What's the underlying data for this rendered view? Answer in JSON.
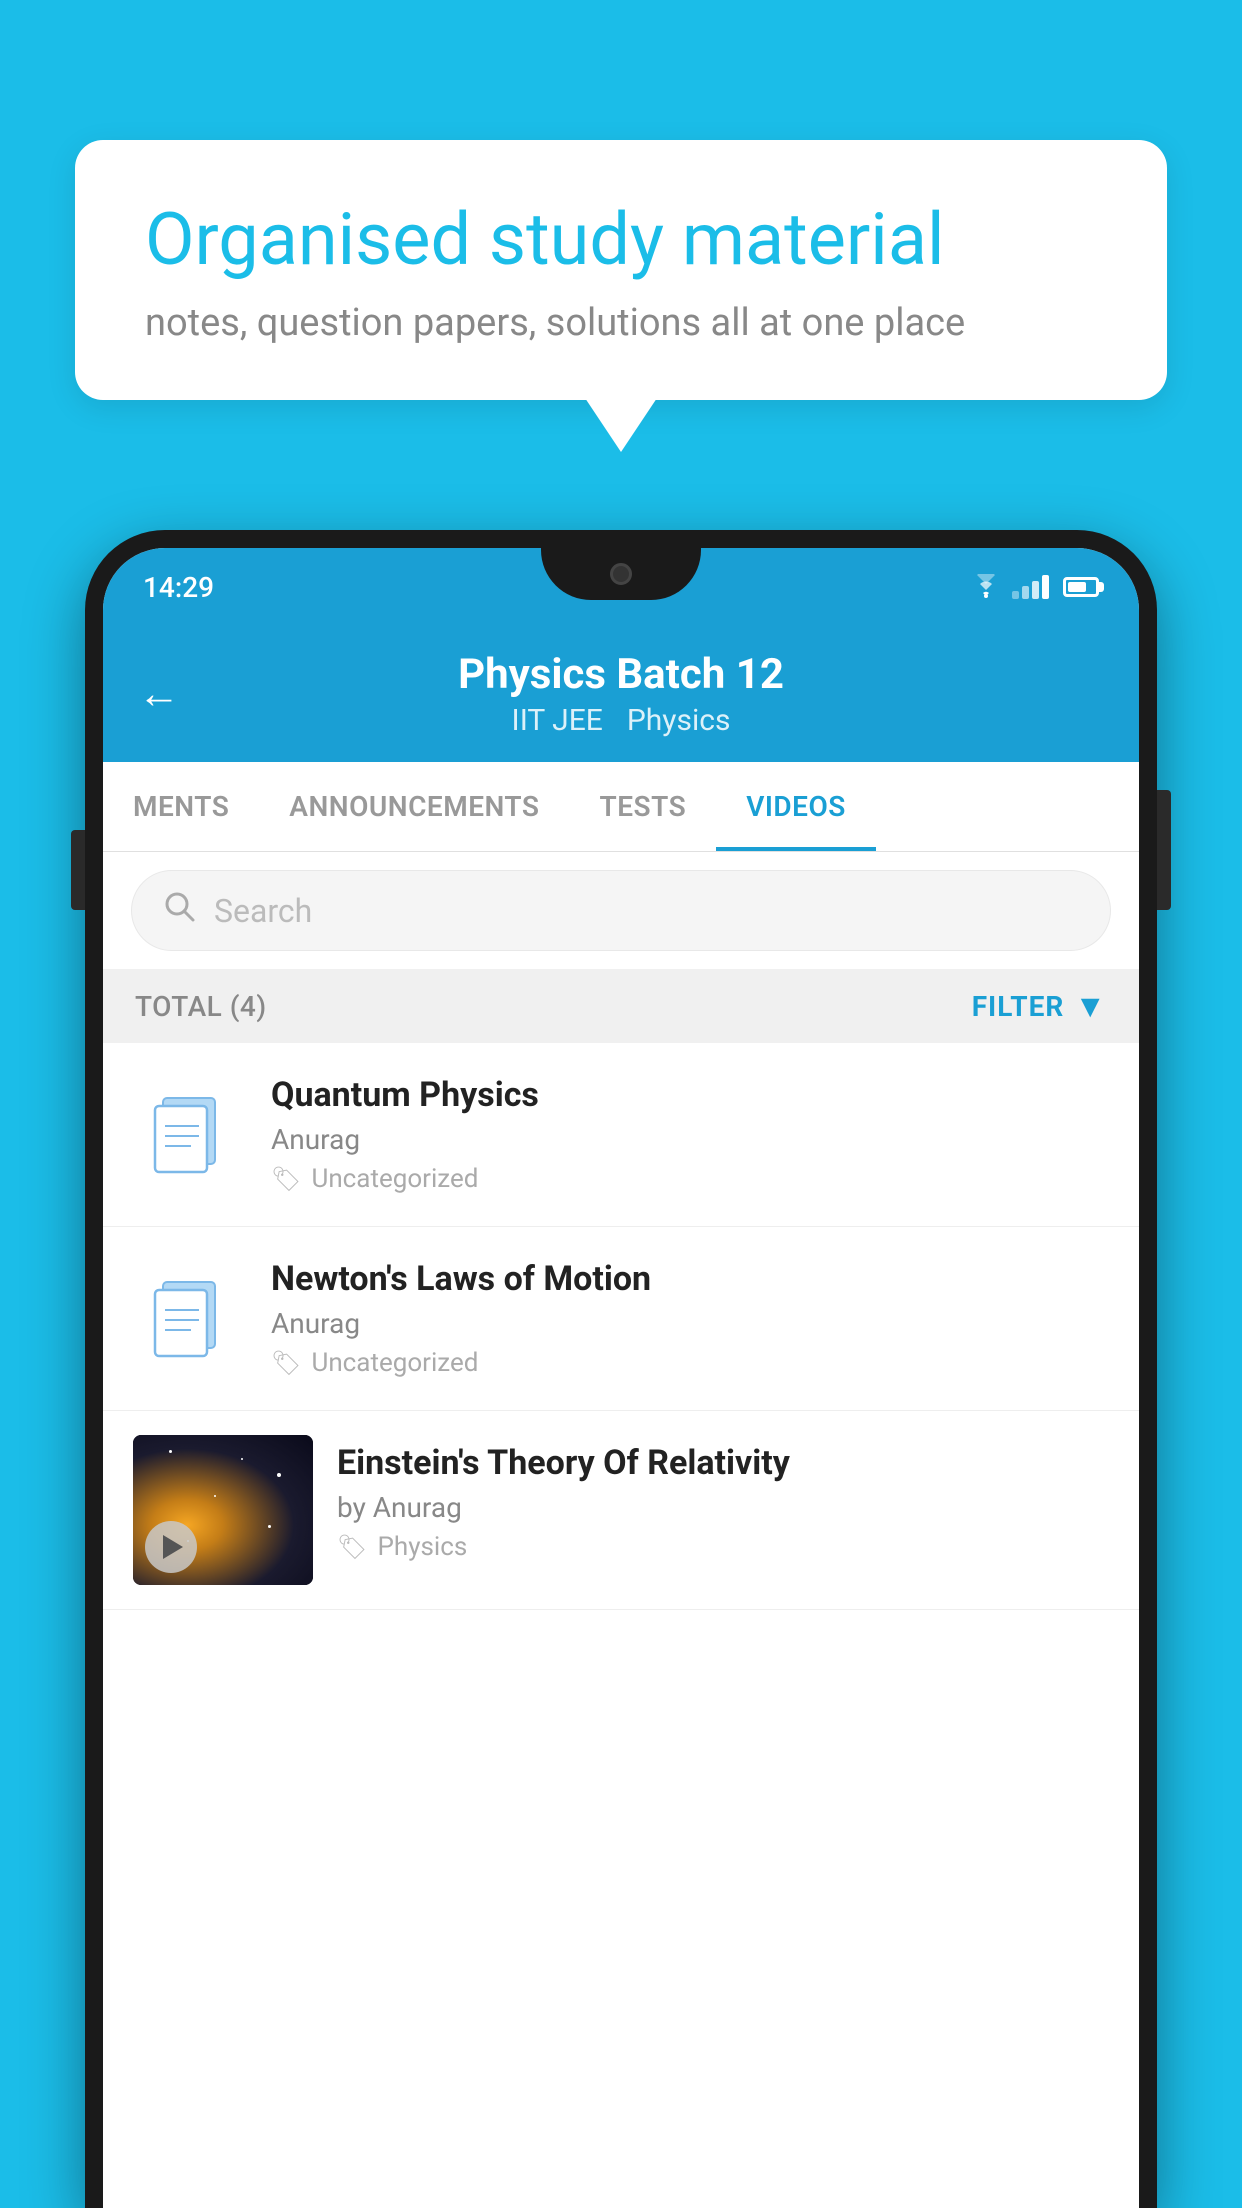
{
  "background": {
    "color": "#1bbde8"
  },
  "speech_bubble": {
    "heading": "Organised study material",
    "subtext": "notes, question papers, solutions all at one place"
  },
  "phone": {
    "status_bar": {
      "time": "14:29"
    },
    "header": {
      "title": "Physics Batch 12",
      "subtitle_left": "IIT JEE",
      "subtitle_right": "Physics",
      "back_label": "←"
    },
    "tabs": [
      {
        "label": "MENTS",
        "active": false
      },
      {
        "label": "ANNOUNCEMENTS",
        "active": false
      },
      {
        "label": "TESTS",
        "active": false
      },
      {
        "label": "VIDEOS",
        "active": true
      }
    ],
    "search": {
      "placeholder": "Search"
    },
    "filter_bar": {
      "total_label": "TOTAL (4)",
      "filter_label": "FILTER"
    },
    "videos": [
      {
        "id": 1,
        "title": "Quantum Physics",
        "author": "Anurag",
        "tag": "Uncategorized",
        "type": "file"
      },
      {
        "id": 2,
        "title": "Newton's Laws of Motion",
        "author": "Anurag",
        "tag": "Uncategorized",
        "type": "file"
      },
      {
        "id": 3,
        "title": "Einstein's Theory Of Relativity",
        "author": "by Anurag",
        "tag": "Physics",
        "type": "video"
      }
    ]
  }
}
